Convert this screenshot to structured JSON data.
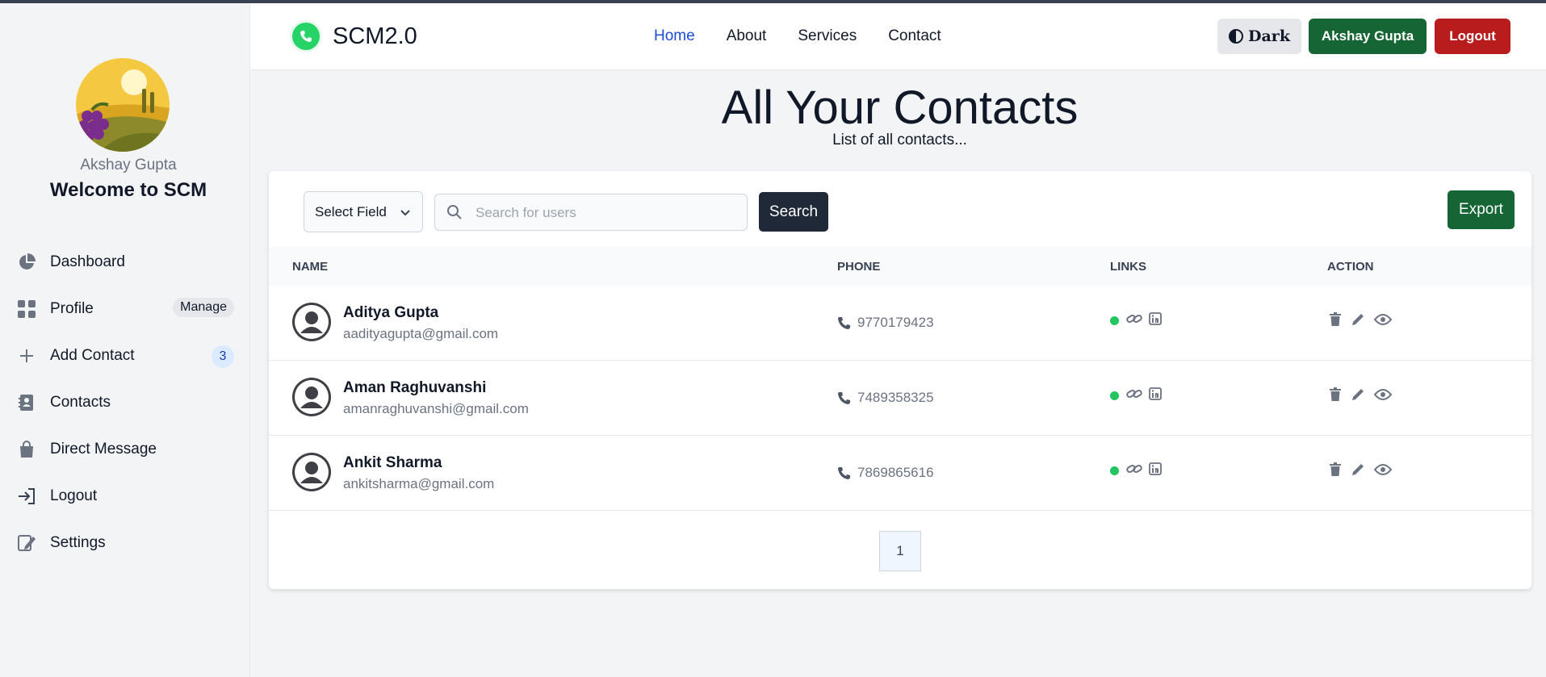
{
  "sidebar": {
    "user_name": "Akshay Gupta",
    "welcome": "Welcome to SCM",
    "items": [
      {
        "label": "Dashboard",
        "icon": "pie-chart-icon"
      },
      {
        "label": "Profile",
        "icon": "grid-icon",
        "tag": "Manage"
      },
      {
        "label": "Add Contact",
        "icon": "plus-icon",
        "count": "3"
      },
      {
        "label": "Contacts",
        "icon": "address-book-icon"
      },
      {
        "label": "Direct Message",
        "icon": "shopping-bag-icon"
      },
      {
        "label": "Logout",
        "icon": "sign-in-icon"
      },
      {
        "label": "Settings",
        "icon": "edit-icon"
      }
    ]
  },
  "navbar": {
    "brand": "SCM2.0",
    "links": [
      "Home",
      "About",
      "Services",
      "Contact"
    ],
    "active_link": "Home",
    "dark_label": "Dark",
    "user_button": "Akshay Gupta",
    "logout_button": "Logout"
  },
  "page": {
    "title": "All Your Contacts",
    "subtitle": "List of all contacts..."
  },
  "toolbar": {
    "select_value": "Select Field",
    "search_placeholder": "Search for users",
    "search_button": "Search",
    "export_button": "Export"
  },
  "table": {
    "headers": [
      "NAME",
      "PHONE",
      "LINKS",
      "ACTION"
    ],
    "rows": [
      {
        "name": "Aditya Gupta",
        "email": "aadityagupta@gmail.com",
        "phone": "9770179423"
      },
      {
        "name": "Aman Raghuvanshi",
        "email": "amanraghuvanshi@gmail.com",
        "phone": "7489358325"
      },
      {
        "name": "Ankit Sharma",
        "email": "ankitsharma@gmail.com",
        "phone": "7869865616"
      }
    ]
  },
  "pagination": {
    "current_page": "1"
  },
  "colors": {
    "accent_green": "#166534",
    "danger_red": "#b91c1c",
    "active_link": "#1d4ed8",
    "status_green": "#22c55e"
  }
}
